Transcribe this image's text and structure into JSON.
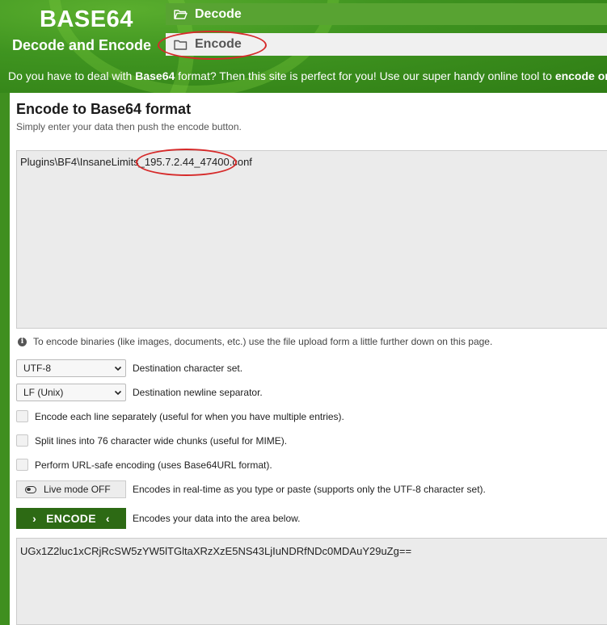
{
  "header": {
    "logo_title": "BASE64",
    "logo_subtitle": "Decode and Encode",
    "nav": {
      "decode_label": "Decode",
      "encode_label": "Encode"
    },
    "tagline_prefix": "Do you have to deal with ",
    "tagline_bold": "Base64",
    "tagline_middle": " format? Then this site is perfect for you! Use our super handy online tool to ",
    "tagline_bold2": "encode or decode your data."
  },
  "panel": {
    "title": "Encode to Base64 format",
    "subtitle": "Simply enter your data then push the encode button.",
    "input_value": "Plugins\\BF4\\InsaneLimits_195.7.2.44_47400.conf",
    "info_text": "To encode binaries (like images, documents, etc.) use the file upload form a little further down on this page.",
    "charset": {
      "selected": "UTF-8",
      "label": "Destination character set."
    },
    "newline": {
      "selected": "LF (Unix)",
      "label": "Destination newline separator."
    },
    "options": {
      "each_line": "Encode each line separately (useful for when you have multiple entries).",
      "split_lines": "Split lines into 76 character wide chunks (useful for MIME).",
      "url_safe": "Perform URL-safe encoding (uses Base64URL format)."
    },
    "live_mode": {
      "button_label": "Live mode OFF",
      "description": "Encodes in real-time as you type or paste (supports only the UTF-8 character set)."
    },
    "encode": {
      "button_label": "ENCODE",
      "description": "Encodes your data into the area below."
    },
    "output_value": "UGx1Z2luc1xCRjRcSW5zYW5lTGltaXRzXzE5NS43LjIuNDRfNDc0MDAuY29uZg=="
  },
  "colors": {
    "header_green": "#3f9420",
    "nav_active_bg": "#58a332",
    "encode_button": "#2d6a14",
    "annotation_red": "#d62a2a"
  }
}
